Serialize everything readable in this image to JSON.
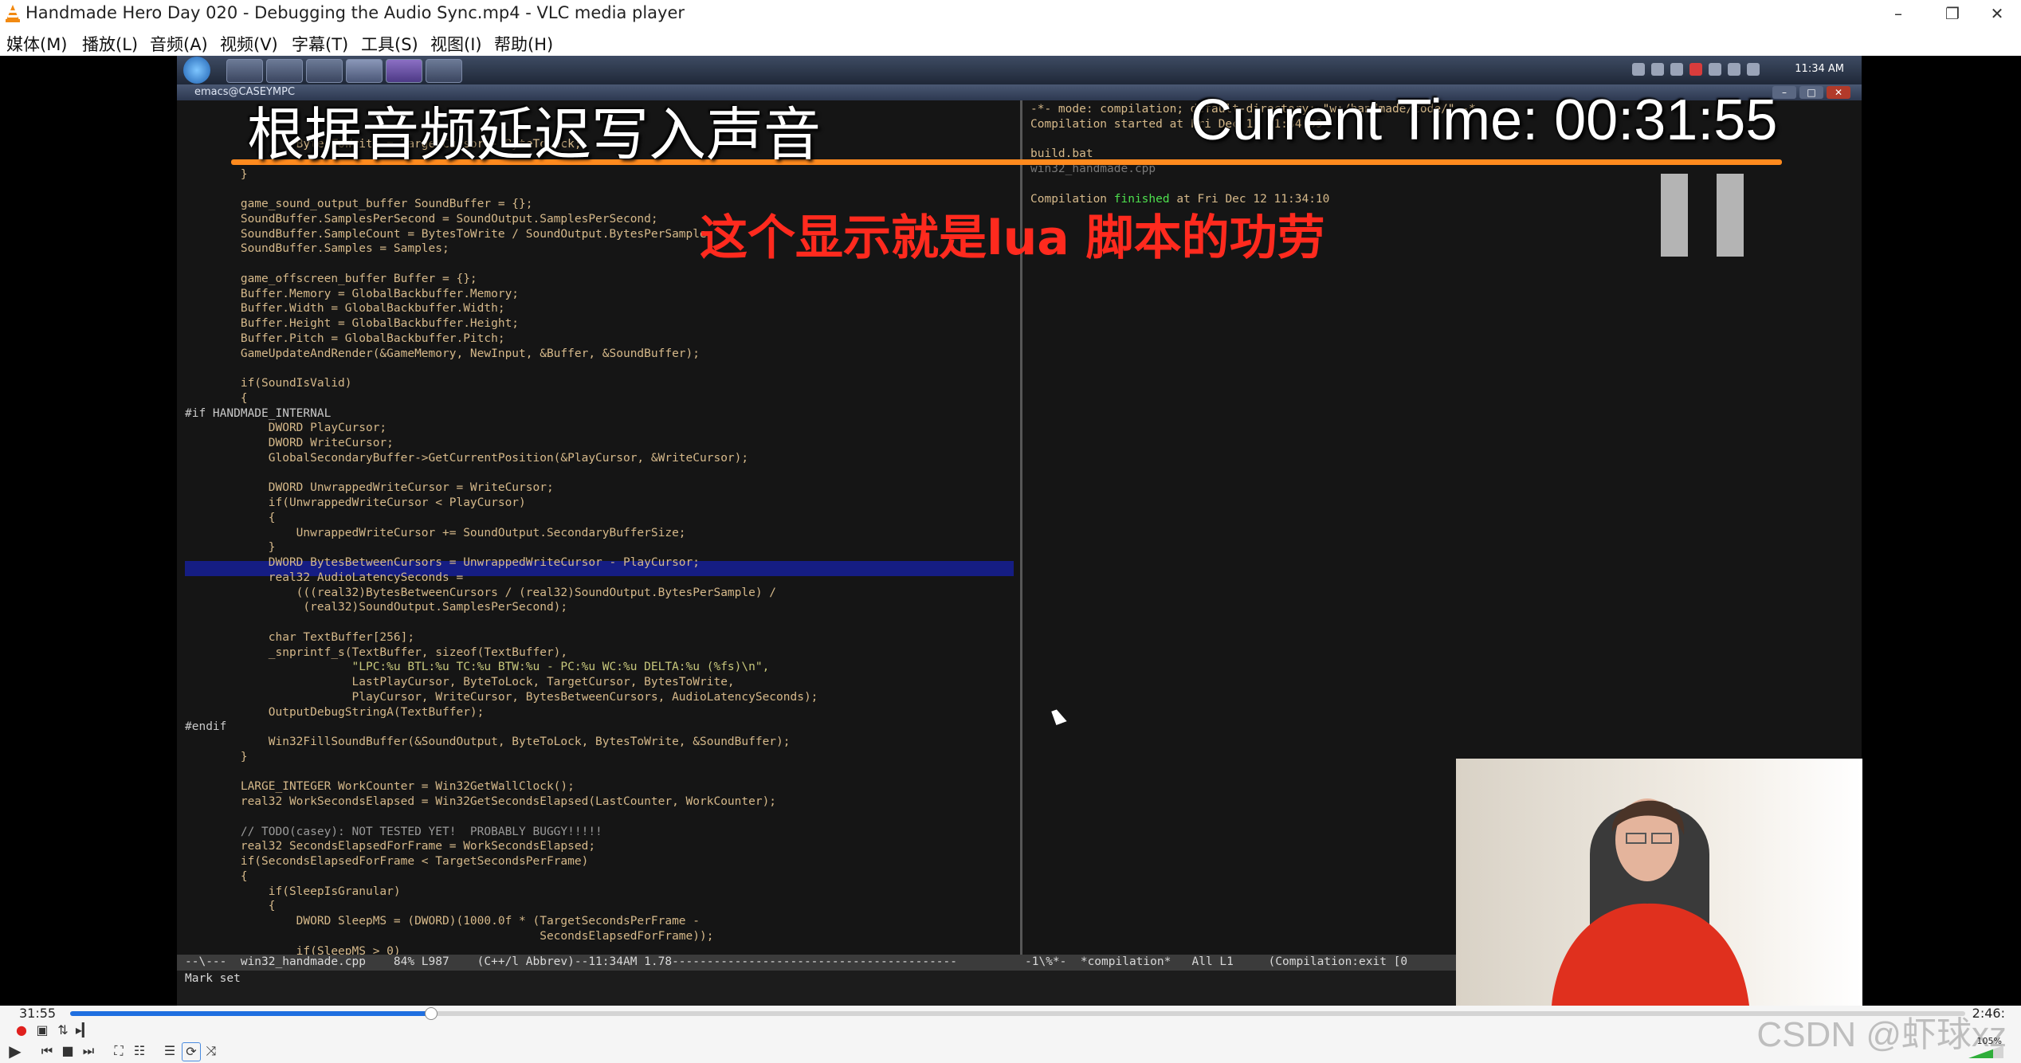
{
  "window": {
    "title": "Handmade Hero Day 020 - Debugging the Audio Sync.mp4 - VLC media player",
    "controls": {
      "minimize": "–",
      "maximize": "❐",
      "close": "✕"
    }
  },
  "menubar": [
    "媒体(M)",
    "播放(L)",
    "音频(A)",
    "视频(V)",
    "字幕(T)",
    "工具(S)",
    "视图(I)",
    "帮助(H)"
  ],
  "video": {
    "taskbar_clock": "11:34 AM",
    "emacs_title": "emacs@CASEYMPC",
    "subtitle": "根据音频延迟写入声音",
    "current_time_overlay": "Current Time: 00:31:55",
    "annotation": "这个显示就是lua 脚本的功劳",
    "code_lines": [
      "                BytesToWrite = TargetCursor - ByteToLock;",
      "            }",
      "        }",
      "",
      "        game_sound_output_buffer SoundBuffer = {};",
      "        SoundBuffer.SamplesPerSecond = SoundOutput.SamplesPerSecond;",
      "        SoundBuffer.SampleCount = BytesToWrite / SoundOutput.BytesPerSample;",
      "        SoundBuffer.Samples = Samples;",
      "",
      "        game_offscreen_buffer Buffer = {};",
      "        Buffer.Memory = GlobalBackbuffer.Memory;",
      "        Buffer.Width = GlobalBackbuffer.Width;",
      "        Buffer.Height = GlobalBackbuffer.Height;",
      "        Buffer.Pitch = GlobalBackbuffer.Pitch;",
      "        GameUpdateAndRender(&GameMemory, NewInput, &Buffer, &SoundBuffer);",
      "",
      "        if(SoundIsValid)",
      "        {",
      "#if HANDMADE_INTERNAL",
      "            DWORD PlayCursor;",
      "            DWORD WriteCursor;",
      "            GlobalSecondaryBuffer->GetCurrentPosition(&PlayCursor, &WriteCursor);",
      "",
      "            DWORD UnwrappedWriteCursor = WriteCursor;",
      "            if(UnwrappedWriteCursor < PlayCursor)",
      "            {",
      "                UnwrappedWriteCursor += SoundOutput.SecondaryBufferSize;",
      "            }",
      "            DWORD BytesBetweenCursors = UnwrappedWriteCursor - PlayCursor;",
      "            real32 AudioLatencySeconds =",
      "                (((real32)BytesBetweenCursors / (real32)SoundOutput.BytesPerSample) /",
      "                 (real32)SoundOutput.SamplesPerSecond);",
      "",
      "            char TextBuffer[256];",
      "            _snprintf_s(TextBuffer, sizeof(TextBuffer),",
      "                        \"LPC:%u BTL:%u TC:%u BTW:%u - PC:%u WC:%u DELTA:%u (%fs)\\n\",",
      "                        LastPlayCursor, ByteToLock, TargetCursor, BytesToWrite,",
      "                        PlayCursor, WriteCursor, BytesBetweenCursors, AudioLatencySeconds);",
      "            OutputDebugStringA(TextBuffer);",
      "#endif",
      "            Win32FillSoundBuffer(&SoundOutput, ByteToLock, BytesToWrite, &SoundBuffer);",
      "        }",
      "",
      "        LARGE_INTEGER WorkCounter = Win32GetWallClock();",
      "        real32 WorkSecondsElapsed = Win32GetSecondsElapsed(LastCounter, WorkCounter);",
      "",
      "        // TODO(casey): NOT TESTED YET!  PROBABLY BUGGY!!!!!",
      "        real32 SecondsElapsedForFrame = WorkSecondsElapsed;",
      "        if(SecondsElapsedForFrame < TargetSecondsPerFrame)",
      "        {",
      "            if(SleepIsGranular)",
      "            {",
      "                DWORD SleepMS = (DWORD)(1000.0f * (TargetSecondsPerFrame -",
      "                                                   SecondsElapsedForFrame));",
      "                if(SleepMS > 0)"
    ],
    "compilation": {
      "header": "-*- mode: compilation; default-directory: \"w:/handmade/code/\" -*-",
      "started": "Compilation started at Fri Dec 12 11:34:09",
      "cmd1": "build.bat",
      "cmd2": "win32_handmade.cpp",
      "finished_prefix": "Compilation ",
      "finished_word": "finished",
      "finished_suffix": " at Fri Dec 12 11:34:10"
    },
    "modeline_left": "--\\---  win32_handmade.cpp    84% L987    (C++/l Abbrev)--11:34AM 1.78-----------------------------------------",
    "modeline_right": "-1\\%*-  *compilation*   All L1     (Compilation:exit [0",
    "minibuffer": "Mark set"
  },
  "player": {
    "elapsed": "31:55",
    "total": "2:46:",
    "progress_fraction": 0.19,
    "volume_label": "105%",
    "watermark": "CSDN @虾球xz"
  }
}
